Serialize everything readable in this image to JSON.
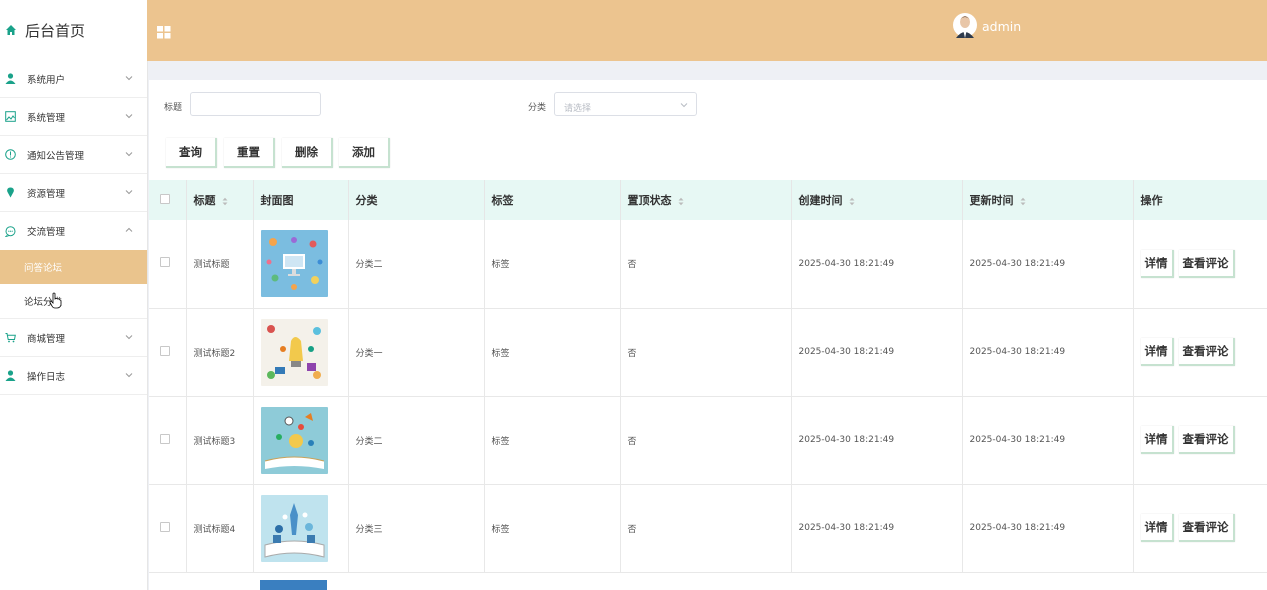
{
  "sidebar": {
    "brand": "后台首页",
    "items": [
      {
        "label": "系统用户",
        "icon": "user-icon",
        "expanded": false
      },
      {
        "label": "系统管理",
        "icon": "image-icon",
        "expanded": false
      },
      {
        "label": "通知公告管理",
        "icon": "info-circle-icon",
        "expanded": false
      },
      {
        "label": "资源管理",
        "icon": "location-pin-icon",
        "expanded": false
      },
      {
        "label": "交流管理",
        "icon": "chat-bubble-icon",
        "expanded": true,
        "children": [
          {
            "label": "问答论坛",
            "active": true
          },
          {
            "label": "论坛分类",
            "active": false
          }
        ]
      },
      {
        "label": "商城管理",
        "icon": "cart-icon",
        "expanded": false
      },
      {
        "label": "操作日志",
        "icon": "user-icon",
        "expanded": false
      }
    ]
  },
  "header": {
    "username": "admin"
  },
  "search": {
    "title_label": "标题",
    "title_value": "",
    "category_label": "分类",
    "category_placeholder": "请选择"
  },
  "actions": {
    "query": "查询",
    "reset": "重置",
    "delete": "删除",
    "add": "添加"
  },
  "table": {
    "columns": [
      "标题",
      "封面图",
      "分类",
      "标签",
      "置顶状态",
      "创建时间",
      "更新时间",
      "操作"
    ],
    "rows": [
      {
        "title": "测试标题",
        "category": "分类二",
        "tag": "标签",
        "pinned": "否",
        "created": "2025-04-30 18:21:49",
        "updated": "2025-04-30 18:21:49"
      },
      {
        "title": "测试标题2",
        "category": "分类一",
        "tag": "标签",
        "pinned": "否",
        "created": "2025-04-30 18:21:49",
        "updated": "2025-04-30 18:21:49"
      },
      {
        "title": "测试标题3",
        "category": "分类二",
        "tag": "标签",
        "pinned": "否",
        "created": "2025-04-30 18:21:49",
        "updated": "2025-04-30 18:21:49"
      },
      {
        "title": "测试标题4",
        "category": "分类三",
        "tag": "标签",
        "pinned": "否",
        "created": "2025-04-30 18:21:49",
        "updated": "2025-04-30 18:21:49"
      }
    ],
    "row_actions": {
      "detail": "详情",
      "comments": "查看评论"
    }
  },
  "colors": {
    "header": "#ecc48f",
    "active_menu": "#eac48d",
    "table_header": "#e7f8f4",
    "accent_icon": "#1aa28a"
  }
}
